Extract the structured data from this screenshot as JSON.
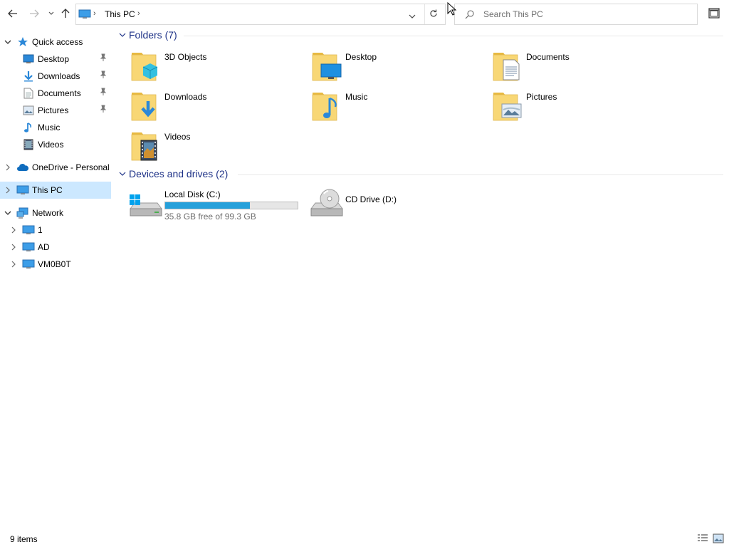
{
  "window": {
    "title": "This PC"
  },
  "toolbar": {
    "back_icon": "arrow-left-icon",
    "forward_icon": "arrow-right-icon",
    "recent_icon": "chevron-down-icon",
    "up_icon": "arrow-up-icon"
  },
  "address_bar": {
    "icon": "this-pc-icon",
    "crumb": "This PC",
    "dropdown_icon": "chevron-down-icon",
    "refresh_icon": "refresh-icon"
  },
  "search": {
    "placeholder": "Search This PC",
    "icon": "search-icon"
  },
  "nav_pane": {
    "quick_access": {
      "label": "Quick access",
      "items": [
        {
          "label": "Desktop",
          "icon": "desktop-icon",
          "pinned": true
        },
        {
          "label": "Downloads",
          "icon": "downloads-icon",
          "pinned": true
        },
        {
          "label": "Documents",
          "icon": "documents-icon",
          "pinned": true
        },
        {
          "label": "Pictures",
          "icon": "pictures-icon",
          "pinned": true
        },
        {
          "label": "Music",
          "icon": "music-icon",
          "pinned": false
        },
        {
          "label": "Videos",
          "icon": "videos-icon",
          "pinned": false
        }
      ]
    },
    "onedrive": {
      "label": "OneDrive - Personal"
    },
    "this_pc": {
      "label": "This PC",
      "selected": true
    },
    "network": {
      "label": "Network",
      "items": [
        {
          "label": "1"
        },
        {
          "label": "AD"
        },
        {
          "label": "VM0B0T"
        }
      ]
    }
  },
  "content": {
    "folders_group": {
      "title": "Folders (7)",
      "items": [
        {
          "label": "3D Objects",
          "icon": "3d-objects-folder-icon"
        },
        {
          "label": "Desktop",
          "icon": "desktop-folder-icon"
        },
        {
          "label": "Documents",
          "icon": "documents-folder-icon"
        },
        {
          "label": "Downloads",
          "icon": "downloads-folder-icon"
        },
        {
          "label": "Music",
          "icon": "music-folder-icon"
        },
        {
          "label": "Pictures",
          "icon": "pictures-folder-icon"
        },
        {
          "label": "Videos",
          "icon": "videos-folder-icon"
        }
      ]
    },
    "drives_group": {
      "title": "Devices and drives (2)",
      "items": [
        {
          "label": "Local Disk (C:)",
          "icon": "hard-drive-icon",
          "free_text": "35.8 GB free of 99.3 GB",
          "used_fraction": 0.64
        },
        {
          "label": "CD Drive (D:)",
          "icon": "cd-drive-icon"
        }
      ]
    }
  },
  "status_bar": {
    "item_count": "9 items",
    "details_view_icon": "details-view-icon",
    "large_icons_view_icon": "large-icons-view-icon"
  },
  "colors": {
    "accent": "#0078d7",
    "selection": "#cce8ff",
    "group_title": "#1e3287",
    "progress_fill": "#26a0da",
    "folder": "#f8d775"
  }
}
